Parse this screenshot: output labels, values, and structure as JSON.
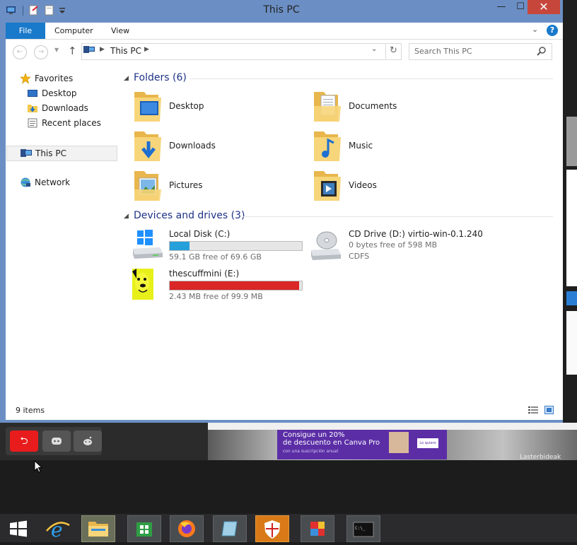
{
  "window": {
    "title": "This PC",
    "controls": {
      "minimize": "—",
      "maximize": "☐",
      "close": "✕"
    }
  },
  "ribbon": {
    "tabs": [
      "File",
      "Computer",
      "View"
    ],
    "help": "?"
  },
  "navbar": {
    "address": "This PC",
    "search_placeholder": "Search This PC"
  },
  "nav_pane": {
    "favorites": "Favorites",
    "favorites_items": [
      "Desktop",
      "Downloads",
      "Recent places"
    ],
    "this_pc": "This PC",
    "network": "Network"
  },
  "folders": {
    "header": "Folders (6)",
    "items": [
      "Desktop",
      "Documents",
      "Downloads",
      "Music",
      "Pictures",
      "Videos"
    ]
  },
  "drives": {
    "header": "Devices and drives (3)",
    "items": [
      {
        "name": "Local Disk (C:)",
        "free": "59.1 GB free of 69.6 GB",
        "used_fraction": 0.15,
        "bar_color": "#26a0da"
      },
      {
        "name": "CD Drive (D:) virtio-win-0.1.240",
        "free": "0 bytes free of 598 MB",
        "fs": "CDFS"
      },
      {
        "name": "thescuffmini (E:)",
        "free": "2.43 MB free of 99.9 MB",
        "used_fraction": 0.98,
        "bar_color": "#da2626"
      }
    ]
  },
  "status": {
    "items": "9 items"
  },
  "overlay": {
    "ad_line1": "Consigue un 20%",
    "ad_line2": "de descuento en Canva Pro",
    "ad_line3": "con una suscripción anual",
    "ad_button": "Lo quiero",
    "credit": "Lasterbideak"
  },
  "colors": {
    "accent": "#1979ca",
    "close": "#c7463b",
    "group_title": "#1e3287"
  }
}
